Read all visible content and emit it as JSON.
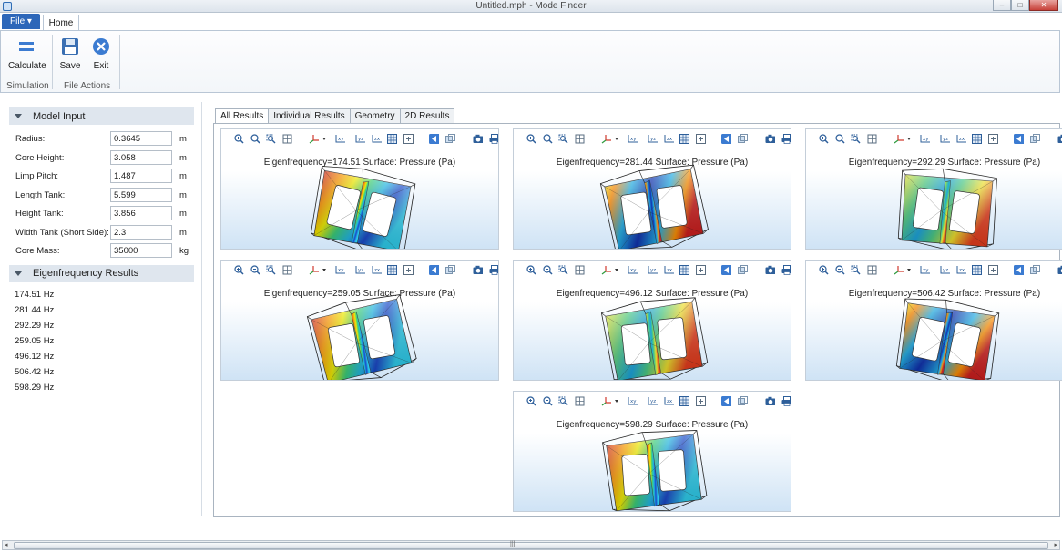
{
  "window": {
    "title": "Untitled.mph - Mode Finder"
  },
  "ribbon": {
    "file_label": "File ▾",
    "home_tab": "Home",
    "buttons": [
      {
        "label": "Calculate",
        "icon": "equals-icon"
      },
      {
        "label": "Save",
        "icon": "floppy-disk-icon"
      },
      {
        "label": "Exit",
        "icon": "close-circle-icon"
      }
    ],
    "groups": [
      "Simulation",
      "File Actions"
    ]
  },
  "model_input": {
    "heading": "Model Input",
    "fields": [
      {
        "label": "Radius:",
        "value": "0.3645",
        "unit": "m"
      },
      {
        "label": "Core Height:",
        "value": "3.058",
        "unit": "m"
      },
      {
        "label": "Limp Pitch:",
        "value": "1.487",
        "unit": "m"
      },
      {
        "label": "Length Tank:",
        "value": "5.599",
        "unit": "m"
      },
      {
        "label": "Height Tank:",
        "value": "3.856",
        "unit": "m"
      },
      {
        "label": "Width Tank (Short Side):",
        "value": "2.3",
        "unit": "m"
      },
      {
        "label": "Core Mass:",
        "value": "35000",
        "unit": "kg"
      }
    ]
  },
  "eigen_results": {
    "heading": "Eigenfrequency Results",
    "items": [
      "174.51 Hz",
      "281.44 Hz",
      "292.29 Hz",
      "259.05 Hz",
      "496.12 Hz",
      "506.42 Hz",
      "598.29 Hz"
    ]
  },
  "tabs": [
    "All Results",
    "Individual Results",
    "Geometry",
    "2D Results"
  ],
  "active_tab": "All Results",
  "plots": [
    {
      "title": "Eigenfrequency=174.51   Surface: Pressure (Pa)"
    },
    {
      "title": "Eigenfrequency=281.44   Surface: Pressure (Pa)"
    },
    {
      "title": "Eigenfrequency=292.29   Surface: Pressure (Pa)"
    },
    {
      "title": "Eigenfrequency=259.05   Surface: Pressure (Pa)"
    },
    {
      "title": "Eigenfrequency=496.12   Surface: Pressure (Pa)"
    },
    {
      "title": "Eigenfrequency=506.42   Surface: Pressure (Pa)"
    },
    {
      "title": "Eigenfrequency=598.29   Surface: Pressure (Pa)"
    }
  ],
  "colors": {
    "file_tab": "#2d67b9",
    "accent": "#3b7bd1",
    "section_head": "#dfe6ee"
  }
}
